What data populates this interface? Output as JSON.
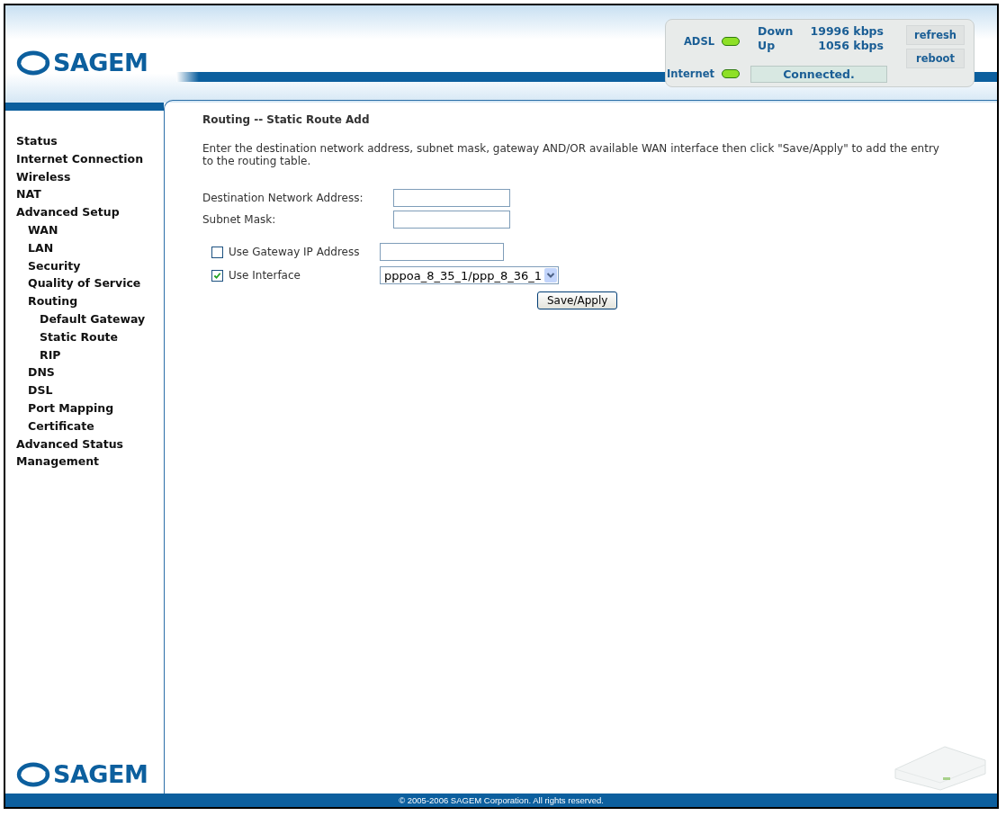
{
  "brand": {
    "logo": "SAGEM",
    "footer_logo": "SAGEM"
  },
  "status_panel": {
    "indicators": [
      {
        "label": "ADSL",
        "on": true
      },
      {
        "label": "Internet",
        "on": true
      }
    ],
    "rates": [
      {
        "direction": "Down",
        "value": "19996 kbps"
      },
      {
        "direction": "Up",
        "value": "1056 kbps"
      }
    ],
    "connection": "Connected.",
    "buttons": [
      "refresh",
      "reboot"
    ]
  },
  "sidebar": {
    "items": [
      {
        "label": "Status"
      },
      {
        "label": "Internet Connection"
      },
      {
        "label": "Wireless"
      },
      {
        "label": "NAT"
      },
      {
        "label": "Advanced Setup",
        "children": [
          {
            "label": "WAN"
          },
          {
            "label": "LAN"
          },
          {
            "label": "Security"
          },
          {
            "label": "Quality of Service"
          },
          {
            "label": "Routing",
            "children": [
              {
                "label": "Default Gateway"
              },
              {
                "label": "Static Route"
              },
              {
                "label": "RIP"
              }
            ]
          },
          {
            "label": "DNS"
          },
          {
            "label": "DSL"
          },
          {
            "label": "Port Mapping"
          },
          {
            "label": "Certificate"
          }
        ]
      },
      {
        "label": "Advanced Status"
      },
      {
        "label": "Management"
      }
    ]
  },
  "main": {
    "title": "Routing -- Static Route Add",
    "description": "Enter the destination network address, subnet mask, gateway AND/OR available WAN interface then click \"Save/Apply\" to add the entry to the routing table.",
    "fields": [
      {
        "label": "Destination Network Address:"
      },
      {
        "label": "Subnet Mask:"
      }
    ],
    "options": [
      {
        "kind": "text",
        "label": "Use Gateway IP Address",
        "checked": false
      },
      {
        "kind": "select",
        "label": "Use Interface",
        "checked": true,
        "value": "pppoa_8_35_1/ppp_8_36_1"
      }
    ],
    "button": "Save/Apply"
  },
  "footer": {
    "copyright": "© 2005-2006 SAGEM Corporation. All rights reserved."
  }
}
